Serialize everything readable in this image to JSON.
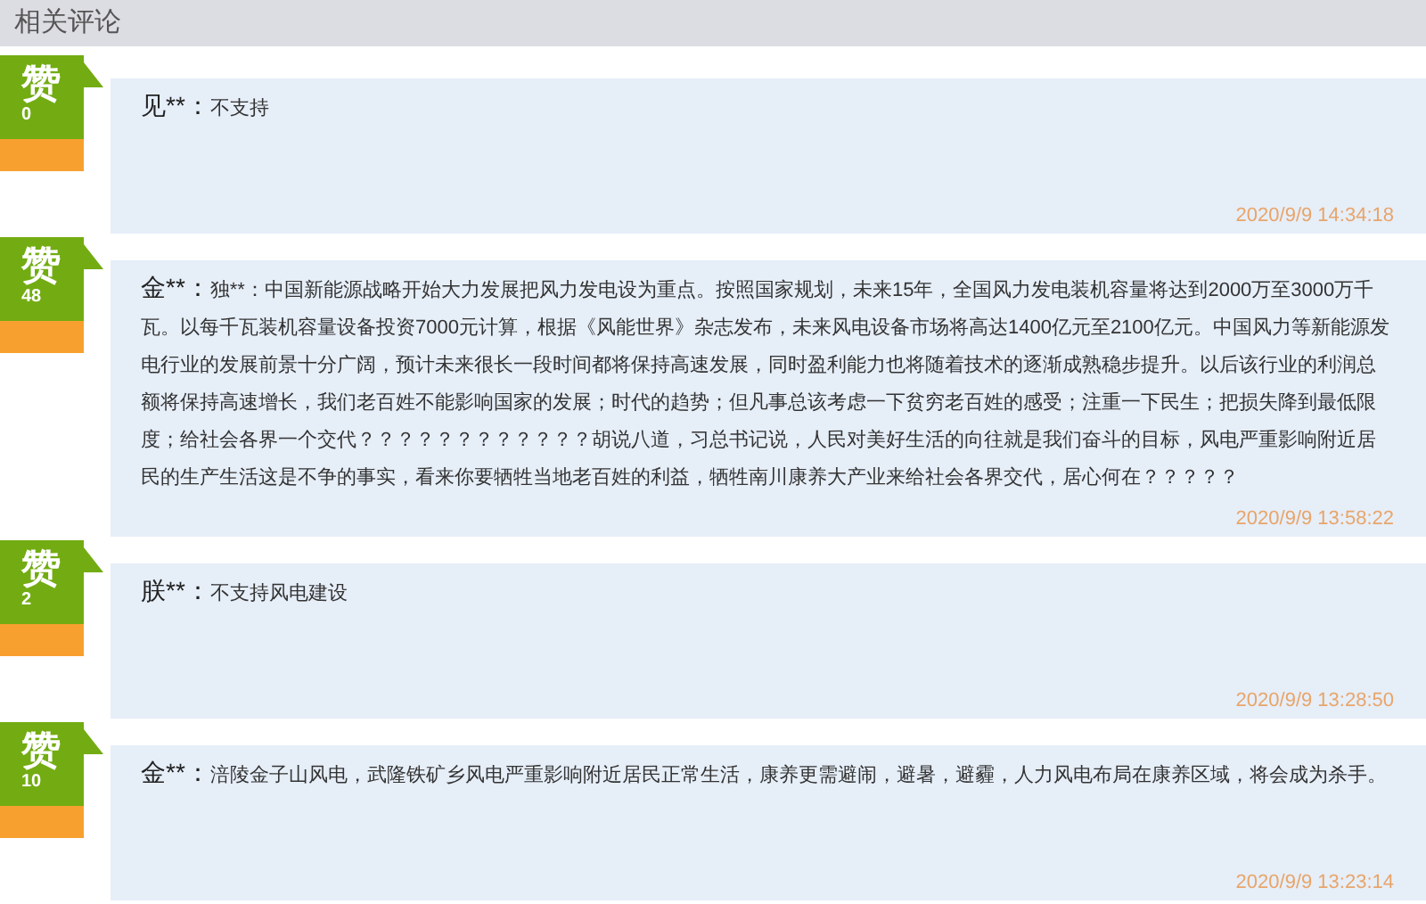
{
  "section_title": "相关评论",
  "comments": [
    {
      "like_label": "赞",
      "likes": "0",
      "author": "见**：",
      "text": "不支持",
      "time": "2020/9/9 14:34:18"
    },
    {
      "like_label": "赞",
      "likes": "48",
      "author": "金**：",
      "text": "独**：中国新能源战略开始大力发展把风力发电设为重点。按照国家规划，未来15年，全国风力发电装机容量将达到2000万至3000万千瓦。以每千瓦装机容量设备投资7000元计算，根据《风能世界》杂志发布，未来风电设备市场将高达1400亿元至2100亿元。中国风力等新能源发电行业的发展前景十分广阔，预计未来很长一段时间都将保持高速发展，同时盈利能力也将随着技术的逐渐成熟稳步提升。以后该行业的利润总额将保持高速增长，我们老百姓不能影响国家的发展；时代的趋势；但凡事总该考虑一下贫穷老百姓的感受；注重一下民生；把损失降到最低限度；给社会各界一个交代？？？？？？？？？？？？胡说八道，习总书记说，人民对美好生活的向往就是我们奋斗的目标，风电严重影响附近居民的生产生活这是不争的事实，看来你要牺牲当地老百姓的利益，牺牲南川康养大产业来给社会各界交代，居心何在？？？？？",
      "time": "2020/9/9 13:58:22"
    },
    {
      "like_label": "赞",
      "likes": "2",
      "author": "朕**：",
      "text": "不支持风电建设",
      "time": "2020/9/9 13:28:50"
    },
    {
      "like_label": "赞",
      "likes": "10",
      "author": "金**：",
      "text": "涪陵金子山风电，武隆铁矿乡风电严重影响附近居民正常生活，康养更需避闹，避暑，避霾，人力风电布局在康养区域，将会成为杀手。",
      "time": "2020/9/9 13:23:14"
    }
  ]
}
